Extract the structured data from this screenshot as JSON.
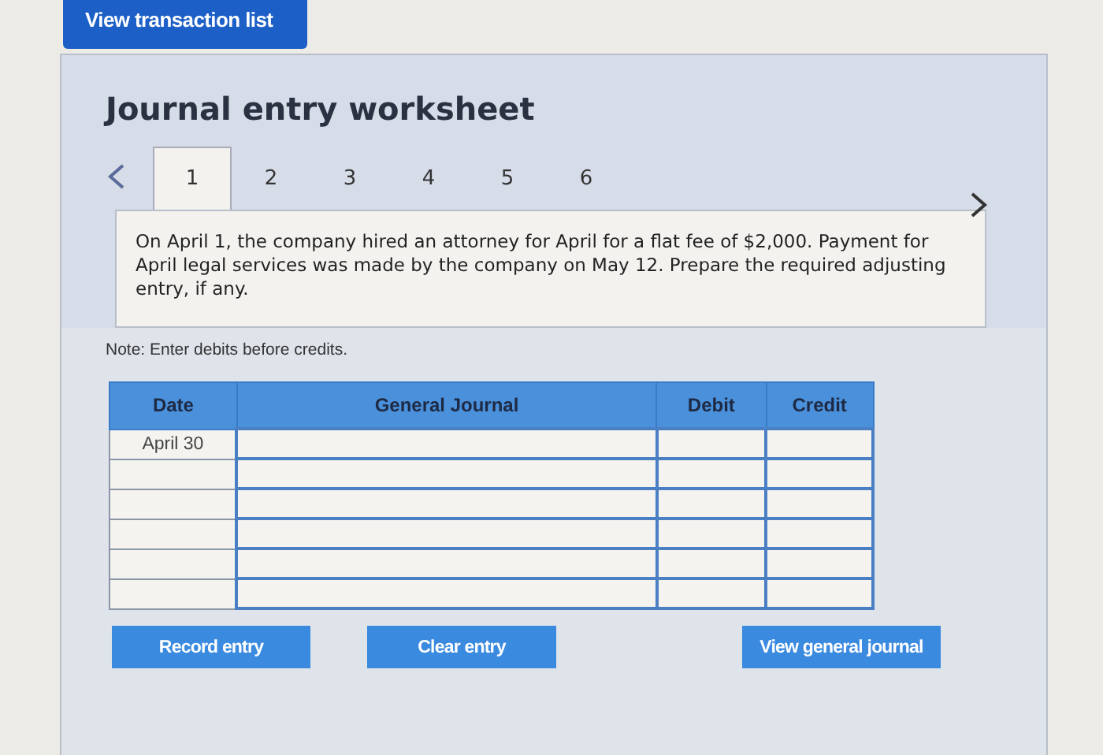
{
  "top_button": "View transaction list",
  "title": "Journal entry worksheet",
  "tabs": [
    {
      "label": "1",
      "selected": true
    },
    {
      "label": "2",
      "selected": false
    },
    {
      "label": "3",
      "selected": false
    },
    {
      "label": "4",
      "selected": false
    },
    {
      "label": "5",
      "selected": false
    },
    {
      "label": "6",
      "selected": false
    }
  ],
  "question": "On April 1, the company hired an attorney for April for a flat fee of $2,000. Payment for April legal services was made by the company on May 12. Prepare the required adjusting entry, if any.",
  "note": "Note: Enter debits before credits.",
  "table": {
    "columns": [
      "Date",
      "General Journal",
      "Debit",
      "Credit"
    ],
    "rows": [
      {
        "date": "April 30"
      },
      {},
      {},
      {},
      {},
      {}
    ]
  },
  "buttons": [
    "Record entry",
    "Clear entry",
    "View general journal"
  ]
}
